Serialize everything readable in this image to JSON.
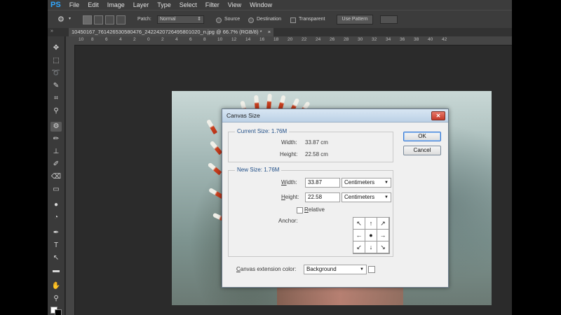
{
  "app": {
    "logo": "PS",
    "menus": [
      "File",
      "Edit",
      "Image",
      "Layer",
      "Type",
      "Select",
      "Filter",
      "View",
      "Window"
    ]
  },
  "options_bar": {
    "patch_label": "Patch:",
    "patch_value": "Normal",
    "source_label": "Source",
    "destination_label": "Destination",
    "transparent_label": "Transparent",
    "use_pattern_label": "Use Pattern"
  },
  "document_tab": {
    "title": "10450167_761426530580476_2422420726495801020_n.jpg @ 66.7% (RGB/8) *",
    "close_glyph": "×"
  },
  "ruler": {
    "h_ticks": [
      "10",
      "8",
      "6",
      "4",
      "2",
      "0",
      "2",
      "4",
      "6",
      "8",
      "10",
      "12",
      "14",
      "16",
      "18",
      "20",
      "22",
      "24",
      "26",
      "28",
      "30",
      "32",
      "34",
      "36",
      "38",
      "40",
      "42"
    ]
  },
  "dialog": {
    "title": "Canvas Size",
    "close_glyph": "✕",
    "current_size": {
      "legend": "Current Size: 1.76M",
      "width_label": "Width:",
      "width_value": "33.87 cm",
      "height_label": "Height:",
      "height_value": "22.58 cm"
    },
    "new_size": {
      "legend": "New Size: 1.76M",
      "width_label": "Width:",
      "width_value": "33.87",
      "width_unit": "Centimeters",
      "height_label": "Height:",
      "height_value": "22.58",
      "height_unit": "Centimeters",
      "relative_label": "Relative",
      "anchor_label": "Anchor:"
    },
    "extension_color_label": "Canvas extension color:",
    "extension_color_value": "Background",
    "ok_label": "OK",
    "cancel_label": "Cancel",
    "anchor_arrows": [
      "↖",
      "↑",
      "↗",
      "←",
      "●",
      "→",
      "↙",
      "↓",
      "↘"
    ]
  }
}
